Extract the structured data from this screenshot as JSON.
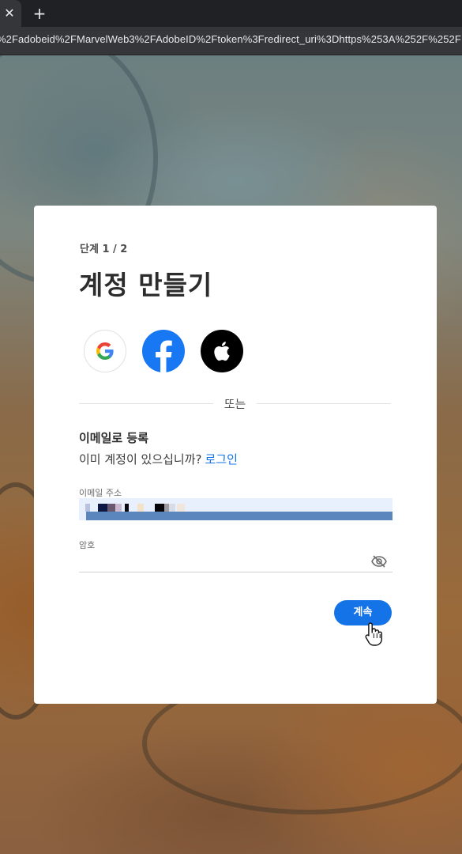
{
  "browser": {
    "tab_close": "✕",
    "new_tab": "+",
    "url": "%2Fadobeid%2FMarvelWeb3%2FAdobeID%2Ftoken%3Fredirect_uri%3Dhttps%253A%252F%252F"
  },
  "signup": {
    "step": "단계 1 / 2",
    "title": "계정 만들기",
    "social_buttons": [
      {
        "name": "Google",
        "icon": "google-icon"
      },
      {
        "name": "Facebook",
        "icon": "facebook-icon"
      },
      {
        "name": "Apple",
        "icon": "apple-icon"
      }
    ],
    "or_text": "또는",
    "email_signup_title": "이메일로 등록",
    "have_account_text": "이미 계정이 있으십니까?",
    "login_link": "로그인",
    "email_label": "이메일 주소",
    "email_value": "",
    "password_label": "암호",
    "password_value": "",
    "continue_label": "계속"
  },
  "colors": {
    "accent": "#1473e6",
    "facebook": "#1877f2",
    "apple": "#000000"
  }
}
